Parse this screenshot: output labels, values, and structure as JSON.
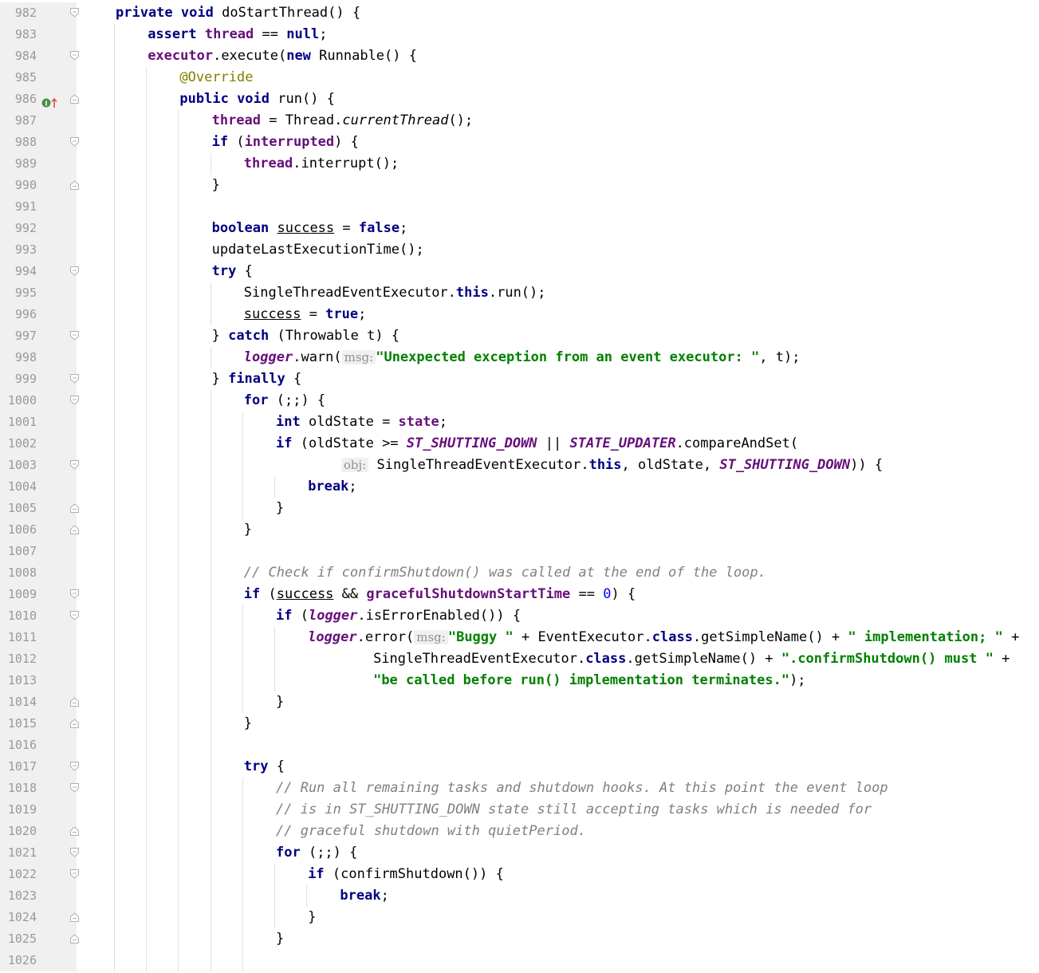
{
  "editor": {
    "language": "Java",
    "colors": {
      "keyword": "#000080",
      "field": "#660e7a",
      "string": "#008000",
      "number": "#0000ff",
      "comment": "#808080",
      "annotation": "#808000",
      "gutter": "#f0f0f0",
      "line_number": "#999999"
    },
    "lines": [
      {
        "n": "982",
        "indent": 1,
        "fold": "open",
        "tokens": [
          {
            "t": "kw",
            "v": "private"
          },
          {
            "t": "p",
            "v": " "
          },
          {
            "t": "kw",
            "v": "void"
          },
          {
            "t": "p",
            "v": " doStartThread() {"
          }
        ]
      },
      {
        "n": "983",
        "indent": 2,
        "tokens": [
          {
            "t": "kw",
            "v": "assert"
          },
          {
            "t": "p",
            "v": " "
          },
          {
            "t": "fld",
            "v": "thread"
          },
          {
            "t": "p",
            "v": " == "
          },
          {
            "t": "kw",
            "v": "null"
          },
          {
            "t": "p",
            "v": ";"
          }
        ]
      },
      {
        "n": "984",
        "indent": 2,
        "fold": "open",
        "tokens": [
          {
            "t": "fld",
            "v": "executor"
          },
          {
            "t": "p",
            "v": ".execute("
          },
          {
            "t": "kw",
            "v": "new"
          },
          {
            "t": "p",
            "v": " Runnable() {"
          }
        ]
      },
      {
        "n": "985",
        "indent": 3,
        "tokens": [
          {
            "t": "ann",
            "v": "@Override"
          }
        ]
      },
      {
        "n": "986",
        "indent": 3,
        "fold": "end",
        "marker": "override-arrow-icon",
        "tokens": [
          {
            "t": "kw",
            "v": "public"
          },
          {
            "t": "p",
            "v": " "
          },
          {
            "t": "kw",
            "v": "void"
          },
          {
            "t": "p",
            "v": " run() {"
          }
        ]
      },
      {
        "n": "987",
        "indent": 4,
        "tokens": [
          {
            "t": "fld",
            "v": "thread"
          },
          {
            "t": "p",
            "v": " = Thread."
          },
          {
            "t": "it",
            "v": "currentThread"
          },
          {
            "t": "p",
            "v": "();"
          }
        ]
      },
      {
        "n": "988",
        "indent": 4,
        "fold": "open",
        "tokens": [
          {
            "t": "kw",
            "v": "if"
          },
          {
            "t": "p",
            "v": " ("
          },
          {
            "t": "fld",
            "v": "interrupted"
          },
          {
            "t": "p",
            "v": ") {"
          }
        ]
      },
      {
        "n": "989",
        "indent": 5,
        "tokens": [
          {
            "t": "fld",
            "v": "thread"
          },
          {
            "t": "p",
            "v": ".interrupt();"
          }
        ]
      },
      {
        "n": "990",
        "indent": 4,
        "fold": "end",
        "tokens": [
          {
            "t": "p",
            "v": "}"
          }
        ]
      },
      {
        "n": "991",
        "indent": 4,
        "tokens": []
      },
      {
        "n": "992",
        "indent": 4,
        "tokens": [
          {
            "t": "kw",
            "v": "boolean"
          },
          {
            "t": "p",
            "v": " "
          },
          {
            "t": "und",
            "v": "success"
          },
          {
            "t": "p",
            "v": " = "
          },
          {
            "t": "kw",
            "v": "false"
          },
          {
            "t": "p",
            "v": ";"
          }
        ]
      },
      {
        "n": "993",
        "indent": 4,
        "tokens": [
          {
            "t": "p",
            "v": "updateLastExecutionTime();"
          }
        ]
      },
      {
        "n": "994",
        "indent": 4,
        "fold": "open",
        "tokens": [
          {
            "t": "kw",
            "v": "try"
          },
          {
            "t": "p",
            "v": " {"
          }
        ]
      },
      {
        "n": "995",
        "indent": 5,
        "tokens": [
          {
            "t": "p",
            "v": "SingleThreadEventExecutor."
          },
          {
            "t": "kw",
            "v": "this"
          },
          {
            "t": "p",
            "v": ".run();"
          }
        ]
      },
      {
        "n": "996",
        "indent": 5,
        "tokens": [
          {
            "t": "und",
            "v": "success"
          },
          {
            "t": "p",
            "v": " = "
          },
          {
            "t": "kw",
            "v": "true"
          },
          {
            "t": "p",
            "v": ";"
          }
        ]
      },
      {
        "n": "997",
        "indent": 4,
        "fold": "open",
        "tokens": [
          {
            "t": "p",
            "v": "} "
          },
          {
            "t": "kw",
            "v": "catch"
          },
          {
            "t": "p",
            "v": " (Throwable t) {"
          }
        ]
      },
      {
        "n": "998",
        "indent": 5,
        "tokens": [
          {
            "t": "sfld",
            "v": "logger"
          },
          {
            "t": "p",
            "v": ".warn("
          },
          {
            "t": "hint",
            "v": "msg:"
          },
          {
            "t": "str",
            "v": "\"Unexpected exception from an event executor: \""
          },
          {
            "t": "p",
            "v": ", t);"
          }
        ]
      },
      {
        "n": "999",
        "indent": 4,
        "fold": "open",
        "tokens": [
          {
            "t": "p",
            "v": "} "
          },
          {
            "t": "kw",
            "v": "finally"
          },
          {
            "t": "p",
            "v": " {"
          }
        ]
      },
      {
        "n": "1000",
        "indent": 5,
        "fold": "open",
        "tokens": [
          {
            "t": "kw",
            "v": "for"
          },
          {
            "t": "p",
            "v": " (;;) {"
          }
        ]
      },
      {
        "n": "1001",
        "indent": 6,
        "tokens": [
          {
            "t": "kw",
            "v": "int"
          },
          {
            "t": "p",
            "v": " oldState = "
          },
          {
            "t": "fld",
            "v": "state"
          },
          {
            "t": "p",
            "v": ";"
          }
        ]
      },
      {
        "n": "1002",
        "indent": 6,
        "tokens": [
          {
            "t": "kw",
            "v": "if"
          },
          {
            "t": "p",
            "v": " (oldState >= "
          },
          {
            "t": "sfld",
            "v": "ST_SHUTTING_DOWN"
          },
          {
            "t": "p",
            "v": " || "
          },
          {
            "t": "sfld",
            "v": "STATE_UPDATER"
          },
          {
            "t": "p",
            "v": ".compareAndSet("
          }
        ]
      },
      {
        "n": "1003",
        "indent": 6,
        "fold": "open",
        "pad": "        ",
        "tokens": [
          {
            "t": "hint",
            "v": "obj:"
          },
          {
            "t": "p",
            "v": " SingleThreadEventExecutor."
          },
          {
            "t": "kw",
            "v": "this"
          },
          {
            "t": "p",
            "v": ", oldState, "
          },
          {
            "t": "sfld",
            "v": "ST_SHUTTING_DOWN"
          },
          {
            "t": "p",
            "v": ")) {"
          }
        ]
      },
      {
        "n": "1004",
        "indent": 7,
        "tokens": [
          {
            "t": "kw",
            "v": "break"
          },
          {
            "t": "p",
            "v": ";"
          }
        ]
      },
      {
        "n": "1005",
        "indent": 6,
        "fold": "end",
        "tokens": [
          {
            "t": "p",
            "v": "}"
          }
        ]
      },
      {
        "n": "1006",
        "indent": 5,
        "fold": "end",
        "tokens": [
          {
            "t": "p",
            "v": "}"
          }
        ]
      },
      {
        "n": "1007",
        "indent": 5,
        "tokens": []
      },
      {
        "n": "1008",
        "indent": 5,
        "tokens": [
          {
            "t": "cmt",
            "v": "// Check if confirmShutdown() was called at the end of the loop."
          }
        ]
      },
      {
        "n": "1009",
        "indent": 5,
        "fold": "open",
        "tokens": [
          {
            "t": "kw",
            "v": "if"
          },
          {
            "t": "p",
            "v": " ("
          },
          {
            "t": "und",
            "v": "success"
          },
          {
            "t": "p",
            "v": " && "
          },
          {
            "t": "fld",
            "v": "gracefulShutdownStartTime"
          },
          {
            "t": "p",
            "v": " == "
          },
          {
            "t": "num",
            "v": "0"
          },
          {
            "t": "p",
            "v": ") {"
          }
        ]
      },
      {
        "n": "1010",
        "indent": 6,
        "fold": "open",
        "tokens": [
          {
            "t": "kw",
            "v": "if"
          },
          {
            "t": "p",
            "v": " ("
          },
          {
            "t": "sfld",
            "v": "logger"
          },
          {
            "t": "p",
            "v": ".isErrorEnabled()) {"
          }
        ]
      },
      {
        "n": "1011",
        "indent": 7,
        "tokens": [
          {
            "t": "sfld",
            "v": "logger"
          },
          {
            "t": "p",
            "v": ".error("
          },
          {
            "t": "hint",
            "v": "msg:"
          },
          {
            "t": "str",
            "v": "\"Buggy \""
          },
          {
            "t": "p",
            "v": " + EventExecutor."
          },
          {
            "t": "kw",
            "v": "class"
          },
          {
            "t": "p",
            "v": ".getSimpleName() + "
          },
          {
            "t": "str",
            "v": "\" implementation; \""
          },
          {
            "t": "p",
            "v": " +"
          }
        ]
      },
      {
        "n": "1012",
        "indent": 7,
        "pad": "        ",
        "tokens": [
          {
            "t": "p",
            "v": "SingleThreadEventExecutor."
          },
          {
            "t": "kw",
            "v": "class"
          },
          {
            "t": "p",
            "v": ".getSimpleName() + "
          },
          {
            "t": "str",
            "v": "\".confirmShutdown() must \""
          },
          {
            "t": "p",
            "v": " +"
          }
        ]
      },
      {
        "n": "1013",
        "indent": 7,
        "pad": "        ",
        "tokens": [
          {
            "t": "str",
            "v": "\"be called before run() implementation terminates.\""
          },
          {
            "t": "p",
            "v": ");"
          }
        ]
      },
      {
        "n": "1014",
        "indent": 6,
        "fold": "end",
        "tokens": [
          {
            "t": "p",
            "v": "}"
          }
        ]
      },
      {
        "n": "1015",
        "indent": 5,
        "fold": "end",
        "tokens": [
          {
            "t": "p",
            "v": "}"
          }
        ]
      },
      {
        "n": "1016",
        "indent": 5,
        "tokens": []
      },
      {
        "n": "1017",
        "indent": 5,
        "fold": "open",
        "tokens": [
          {
            "t": "kw",
            "v": "try"
          },
          {
            "t": "p",
            "v": " {"
          }
        ]
      },
      {
        "n": "1018",
        "indent": 6,
        "fold": "open",
        "tokens": [
          {
            "t": "cmt",
            "v": "// Run all remaining tasks and shutdown hooks. At this point the event loop"
          }
        ]
      },
      {
        "n": "1019",
        "indent": 6,
        "tokens": [
          {
            "t": "cmt",
            "v": "// is in ST_SHUTTING_DOWN state still accepting tasks which is needed for"
          }
        ]
      },
      {
        "n": "1020",
        "indent": 6,
        "fold": "end",
        "tokens": [
          {
            "t": "cmt",
            "v": "// graceful shutdown with quietPeriod."
          }
        ]
      },
      {
        "n": "1021",
        "indent": 6,
        "fold": "open",
        "tokens": [
          {
            "t": "kw",
            "v": "for"
          },
          {
            "t": "p",
            "v": " (;;) {"
          }
        ]
      },
      {
        "n": "1022",
        "indent": 7,
        "fold": "open",
        "tokens": [
          {
            "t": "kw",
            "v": "if"
          },
          {
            "t": "p",
            "v": " (confirmShutdown()) {"
          }
        ]
      },
      {
        "n": "1023",
        "indent": 8,
        "tokens": [
          {
            "t": "kw",
            "v": "break"
          },
          {
            "t": "p",
            "v": ";"
          }
        ]
      },
      {
        "n": "1024",
        "indent": 7,
        "fold": "end",
        "tokens": [
          {
            "t": "p",
            "v": "}"
          }
        ]
      },
      {
        "n": "1025",
        "indent": 6,
        "fold": "end",
        "tokens": [
          {
            "t": "p",
            "v": "}"
          }
        ]
      },
      {
        "n": "1026",
        "indent": 6,
        "tokens": []
      }
    ]
  }
}
